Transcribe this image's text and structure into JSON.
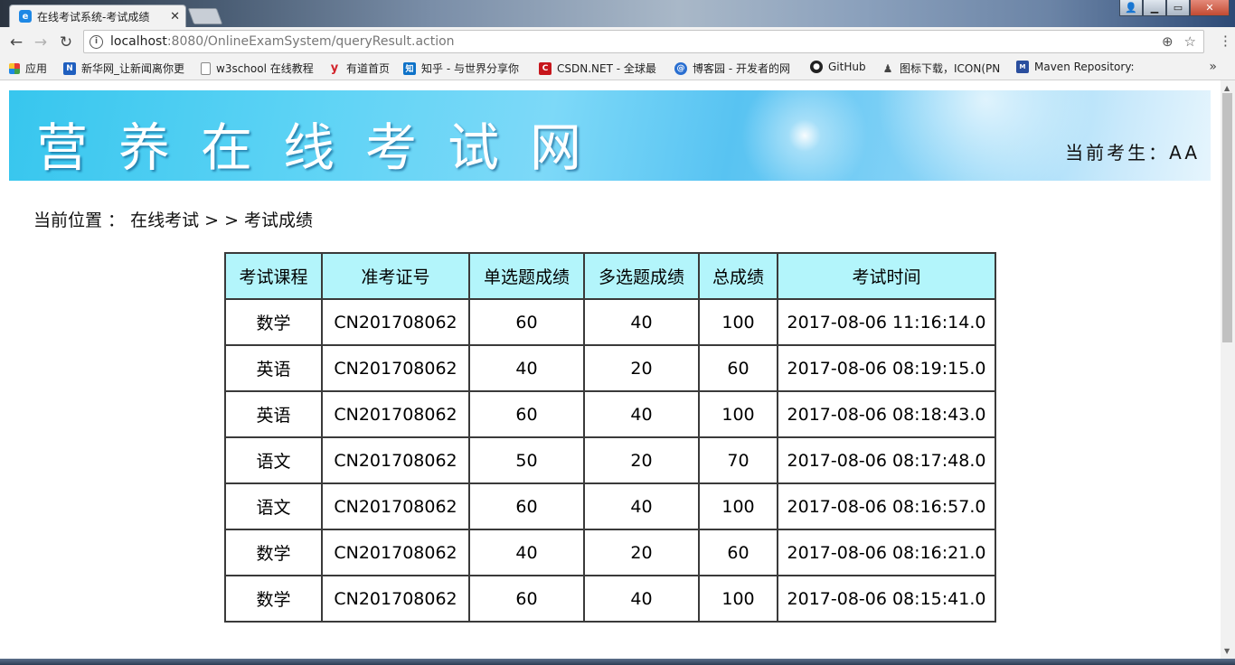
{
  "browser": {
    "tab_title": "在线考试系统-考试成绩",
    "tab_favicon": "e",
    "url_host": "localhost",
    "url_rest": ":8080/OnlineExamSystem/queryResult.action",
    "bookmarks": [
      {
        "label": "应用",
        "icon": "apps-grid-icon",
        "color": "#d33"
      },
      {
        "label": "新华网_让新闻离你更",
        "icon": "news-icon",
        "color": "#1f5fbf"
      },
      {
        "label": "w3school 在线教程",
        "icon": "page-icon",
        "color": "#888888"
      },
      {
        "label": "有道首页",
        "icon": "youdao-icon",
        "color": "#d2232a"
      },
      {
        "label": "知乎 - 与世界分享你",
        "icon": "zhihu-icon",
        "color": "#0e72c8"
      },
      {
        "label": "CSDN.NET - 全球最",
        "icon": "csdn-icon",
        "color": "#c7161c"
      },
      {
        "label": "博客园 - 开发者的网",
        "icon": "cnblogs-icon",
        "color": "#2a6fd1"
      },
      {
        "label": "GitHub",
        "icon": "github-icon",
        "color": "#222222"
      },
      {
        "label": "图标下载，ICON(PN",
        "icon": "iconfont-icon",
        "color": "#444444"
      },
      {
        "label": "Maven Repository:",
        "icon": "maven-icon",
        "color": "#2b4f9e"
      }
    ]
  },
  "banner": {
    "title": "营养在线考试网",
    "current_user": "当前考生：AA"
  },
  "breadcrumb": "当前位置 ： 在线考试 > > 考试成绩",
  "table": {
    "headers": [
      "考试课程",
      "准考证号",
      "单选题成绩",
      "多选题成绩",
      "总成绩",
      "考试时间"
    ],
    "rows": [
      [
        "数学",
        "CN201708062",
        "60",
        "40",
        "100",
        "2017-08-06 11:16:14.0"
      ],
      [
        "英语",
        "CN201708062",
        "40",
        "20",
        "60",
        "2017-08-06 08:19:15.0"
      ],
      [
        "英语",
        "CN201708062",
        "60",
        "40",
        "100",
        "2017-08-06 08:18:43.0"
      ],
      [
        "语文",
        "CN201708062",
        "50",
        "20",
        "70",
        "2017-08-06 08:17:48.0"
      ],
      [
        "语文",
        "CN201708062",
        "60",
        "40",
        "100",
        "2017-08-06 08:16:57.0"
      ],
      [
        "数学",
        "CN201708062",
        "40",
        "20",
        "60",
        "2017-08-06 08:16:21.0"
      ],
      [
        "数学",
        "CN201708062",
        "60",
        "40",
        "100",
        "2017-08-06 08:15:41.0"
      ]
    ]
  },
  "colors": {
    "header_bg": "#b3f5fb",
    "banner_accent": "#37c6ee"
  }
}
